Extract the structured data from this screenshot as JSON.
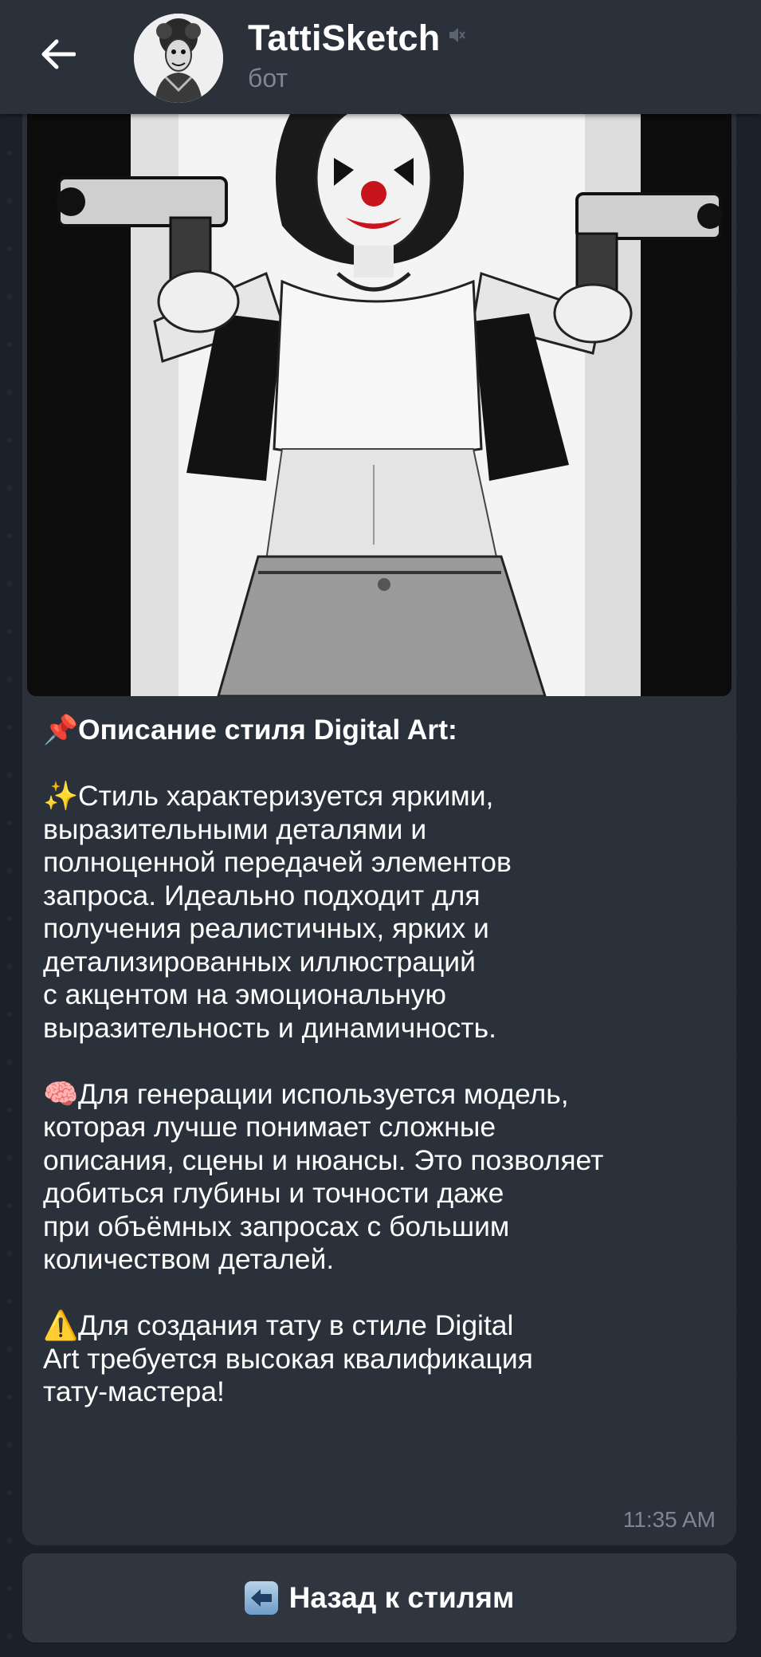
{
  "header": {
    "title": "TattiSketch",
    "subtitle": "бот",
    "back_icon": "arrow-left-icon",
    "mute_icon": "muted-speaker-icon"
  },
  "message": {
    "heading_emoji": "📌",
    "heading": "Описание стиля Digital Art:",
    "para1_emoji": "✨",
    "para1_lines": [
      "Стиль характеризуется яркими,",
      "выразительными деталями и",
      "полноценной передачей элементов",
      "запроса. Идеально подходит для",
      "получения реалистичных, ярких и",
      "детализированных иллюстраций",
      "с акцентом на эмоциональную",
      "выразительность и динамичность."
    ],
    "para2_emoji": "🧠",
    "para2_lines": [
      "Для генерации используется модель,",
      "которая лучше понимает сложные",
      "описания, сцены и нюансы. Это позволяет",
      "добиться глубины и точности даже",
      "при объёмных запросах с большим",
      "количеством деталей."
    ],
    "para3_emoji": "⚠️",
    "para3_lines": [
      "Для создания тату в стиле Digital",
      "Art требуется высокая квалификация",
      "тату-мастера!"
    ],
    "time": "11:35 AM"
  },
  "keyboard": {
    "button_icon": "back-arrow-icon",
    "button_label": "Назад к стилям"
  },
  "colors": {
    "header_bg": "#2b313b",
    "bubble_bg": "#2b313b",
    "chat_bg": "#1b2129",
    "muted_text": "#7d8692"
  }
}
